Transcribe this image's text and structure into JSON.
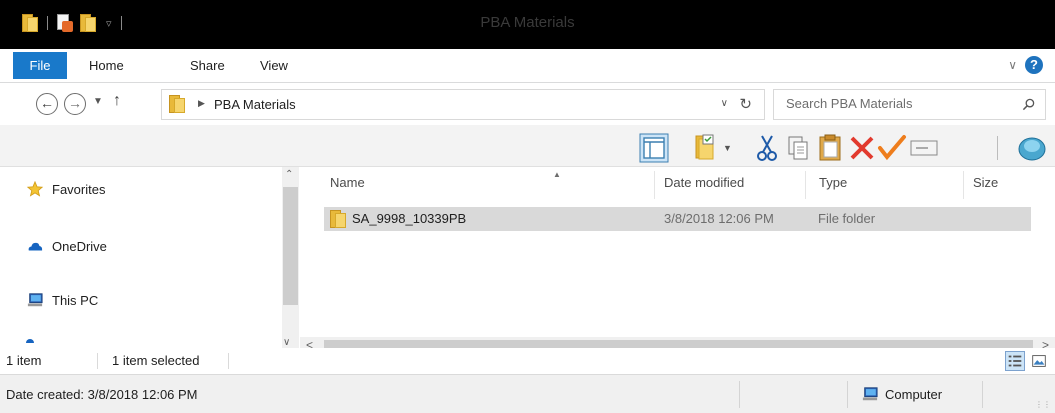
{
  "window": {
    "title": "PBA Materials"
  },
  "qat": {
    "icons": [
      "folder-icon",
      "properties-icon",
      "new-folder-icon",
      "customize-qat-icon"
    ]
  },
  "ribbon": {
    "tabs": [
      {
        "label": "File",
        "active": true
      },
      {
        "label": "Home"
      },
      {
        "label": "Share"
      },
      {
        "label": "View"
      }
    ],
    "colors": {
      "file_tab": "#1979ca"
    }
  },
  "address": {
    "breadcrumb": [
      "PBA Materials"
    ],
    "search_placeholder": "Search PBA Materials"
  },
  "toolbar": {
    "icons": [
      "preview-pane-icon",
      "properties-icon",
      "cut-icon",
      "copy-icon",
      "paste-icon",
      "delete-icon",
      "check-icon",
      "rename-icon",
      "shell-icon"
    ]
  },
  "navpane": {
    "items": [
      {
        "label": "Favorites",
        "icon": "star-icon"
      },
      {
        "label": "OneDrive",
        "icon": "cloud-icon"
      },
      {
        "label": "This PC",
        "icon": "computer-icon"
      }
    ]
  },
  "filelist": {
    "columns": [
      "Name",
      "Date modified",
      "Type",
      "Size"
    ],
    "rows": [
      {
        "name": "SA_9998_10339PB",
        "date_modified": "3/8/2018 12:06 PM",
        "type": "File folder",
        "size": "",
        "selected": true
      }
    ]
  },
  "status": {
    "count": "1 item",
    "selection": "1 item selected"
  },
  "details": {
    "date_created": "Date created: 3/8/2018 12:06 PM",
    "location": "Computer"
  }
}
